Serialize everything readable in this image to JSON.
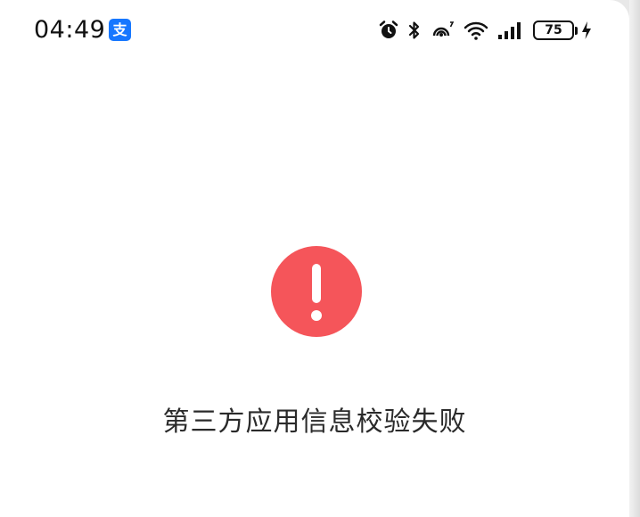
{
  "status_bar": {
    "time": "04:49",
    "app_badge_glyph": "支",
    "battery_level": "75",
    "icons": [
      "alarm-icon",
      "bluetooth-icon",
      "nfc-icon",
      "wifi-icon",
      "signal-icon",
      "battery-icon",
      "charging-icon"
    ]
  },
  "error": {
    "icon": "exclamation-icon",
    "message": "第三方应用信息校验失败"
  },
  "colors": {
    "error_red": "#f5555a",
    "badge_blue": "#1677ff",
    "text": "#2a2a2a",
    "background": "#ffffff"
  }
}
